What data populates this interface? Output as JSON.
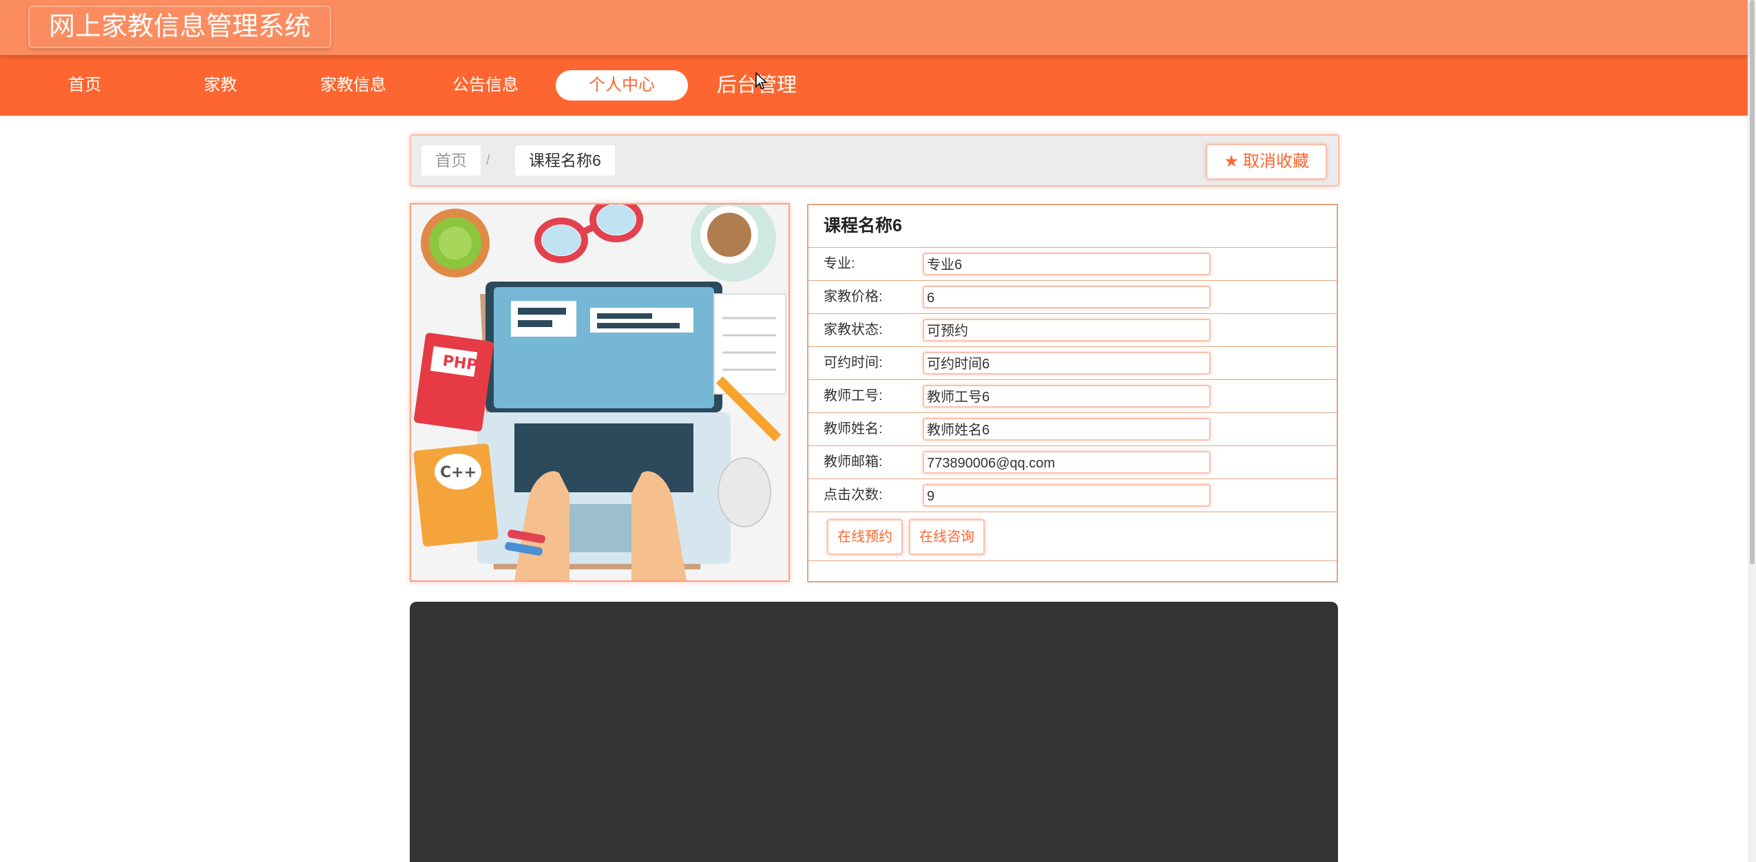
{
  "header": {
    "site_title": "网上家教信息管理系统"
  },
  "nav": {
    "items": [
      {
        "label": "首页",
        "active": false
      },
      {
        "label": "家教",
        "active": false
      },
      {
        "label": "家教信息",
        "active": false
      },
      {
        "label": "公告信息",
        "active": false
      },
      {
        "label": "个人中心",
        "active": true
      },
      {
        "label": "后台管理",
        "active": false
      }
    ]
  },
  "breadcrumb": {
    "home": "首页",
    "separator": "/",
    "current": "课程名称6"
  },
  "favorite_button": {
    "icon": "star-icon",
    "label": "取消收藏"
  },
  "detail": {
    "title": "课程名称6",
    "fields": [
      {
        "label": "专业:",
        "value": "专业6"
      },
      {
        "label": "家教价格:",
        "value": "6"
      },
      {
        "label": "家教状态:",
        "value": "可预约"
      },
      {
        "label": "可约时间:",
        "value": "可约时间6"
      },
      {
        "label": "教师工号:",
        "value": "教师工号6"
      },
      {
        "label": "教师姓名:",
        "value": "教师姓名6"
      },
      {
        "label": "教师邮箱:",
        "value": "773890006@qq.com"
      },
      {
        "label": "点击次数:",
        "value": "9"
      }
    ],
    "actions": {
      "book_label": "在线预约",
      "consult_label": "在线咨询"
    }
  },
  "image": {
    "book_labels": {
      "php": "PHP",
      "cpp": "C++"
    }
  },
  "colors": {
    "header_bg": "#fb8c60",
    "nav_bg": "#fd6630",
    "accent": "#fd6630",
    "border_soft": "#f7c0ad",
    "table_border": "#e2a47f",
    "video_bg": "#333333"
  }
}
